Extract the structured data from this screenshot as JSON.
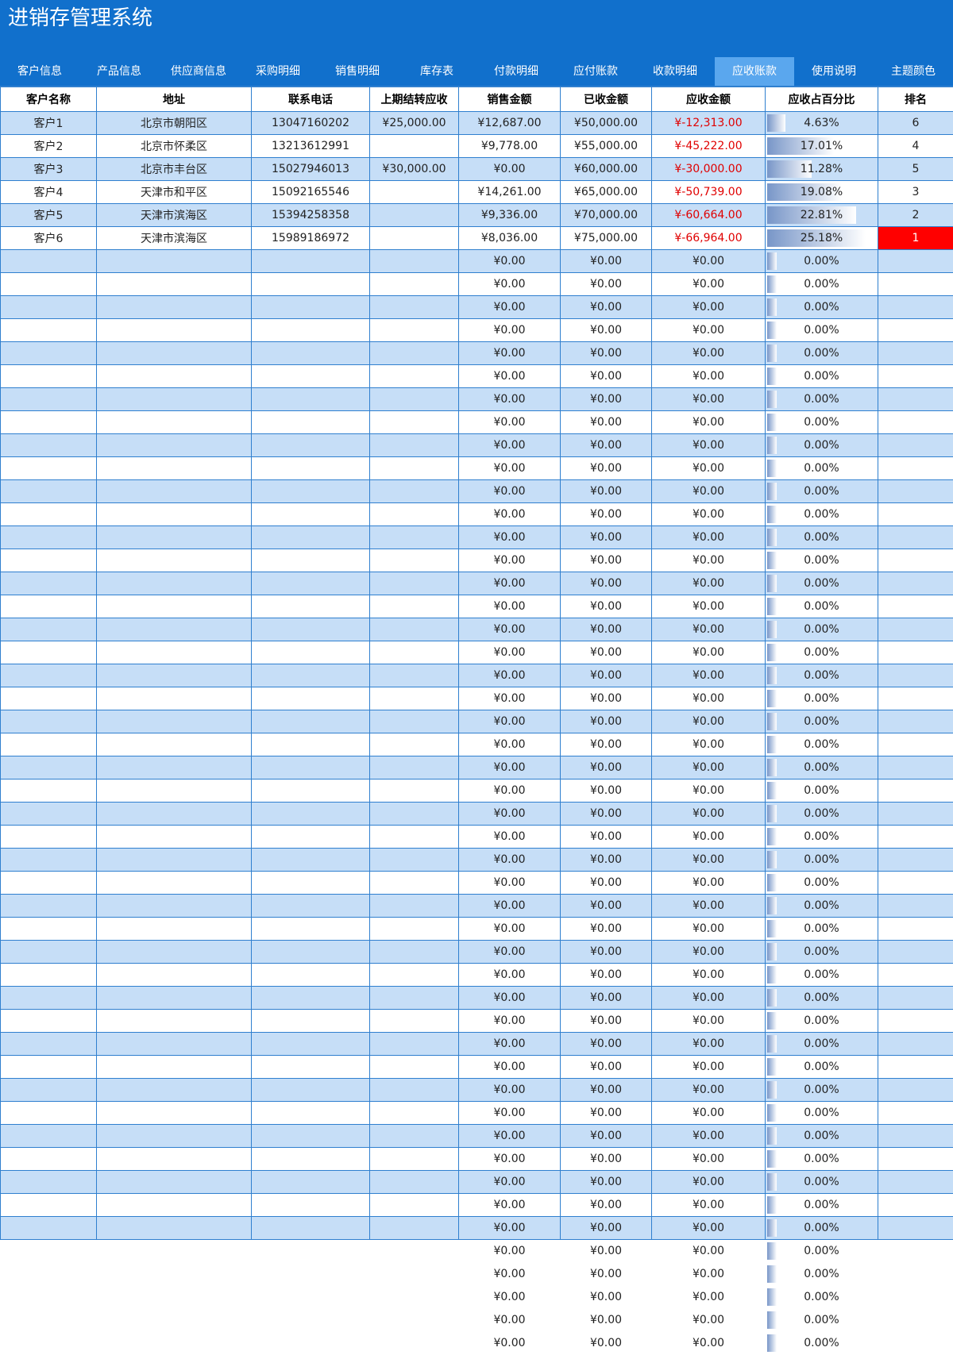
{
  "app": {
    "title": "进销存管理系统"
  },
  "tabs": [
    {
      "label": "客户信息",
      "active": false
    },
    {
      "label": "产品信息",
      "active": false
    },
    {
      "label": "供应商信息",
      "active": false
    },
    {
      "label": "采购明细",
      "active": false
    },
    {
      "label": "销售明细",
      "active": false
    },
    {
      "label": "库存表",
      "active": false
    },
    {
      "label": "付款明细",
      "active": false
    },
    {
      "label": "应付账款",
      "active": false
    },
    {
      "label": "收款明细",
      "active": false
    },
    {
      "label": "应收账款",
      "active": true
    },
    {
      "label": "使用说明",
      "active": false
    },
    {
      "label": "主题颜色",
      "active": false
    }
  ],
  "table": {
    "columns": [
      "客户名称",
      "地址",
      "联系电话",
      "上期结转应收",
      "销售金额",
      "已收金额",
      "应收金额",
      "应收占百分比",
      "排名"
    ],
    "rows": [
      {
        "name": "客户1",
        "address": "北京市朝阳区",
        "phone": "13047160202",
        "carry": "¥25,000.00",
        "sales": "¥12,687.00",
        "received": "¥50,000.00",
        "receivable": "¥-12,313.00",
        "percent": "4.63%",
        "percent_value": 4.63,
        "rank": "6"
      },
      {
        "name": "客户2",
        "address": "北京市怀柔区",
        "phone": "13213612991",
        "carry": "",
        "sales": "¥9,778.00",
        "received": "¥55,000.00",
        "receivable": "¥-45,222.00",
        "percent": "17.01%",
        "percent_value": 17.01,
        "rank": "4"
      },
      {
        "name": "客户3",
        "address": "北京市丰台区",
        "phone": "15027946013",
        "carry": "¥30,000.00",
        "sales": "¥0.00",
        "received": "¥60,000.00",
        "receivable": "¥-30,000.00",
        "percent": "11.28%",
        "percent_value": 11.28,
        "rank": "5"
      },
      {
        "name": "客户4",
        "address": "天津市和平区",
        "phone": "15092165546",
        "carry": "",
        "sales": "¥14,261.00",
        "received": "¥65,000.00",
        "receivable": "¥-50,739.00",
        "percent": "19.08%",
        "percent_value": 19.08,
        "rank": "3"
      },
      {
        "name": "客户5",
        "address": "天津市滨海区",
        "phone": "15394258358",
        "carry": "",
        "sales": "¥9,336.00",
        "received": "¥70,000.00",
        "receivable": "¥-60,664.00",
        "percent": "22.81%",
        "percent_value": 22.81,
        "rank": "2"
      },
      {
        "name": "客户6",
        "address": "天津市滨海区",
        "phone": "15989186972",
        "carry": "",
        "sales": "¥8,036.00",
        "received": "¥75,000.00",
        "receivable": "¥-66,964.00",
        "percent": "25.18%",
        "percent_value": 25.18,
        "rank": "1"
      }
    ],
    "empty_row": {
      "sales": "¥0.00",
      "received": "¥0.00",
      "receivable": "¥0.00",
      "percent": "0.00%"
    }
  },
  "colors": {
    "header_bg": "#1170cc",
    "active_tab": "#5aa7ee",
    "row_alt": "#c6def7",
    "negative": "#e00000",
    "rank_top": "#ff0000",
    "bar": "#7896c8"
  }
}
